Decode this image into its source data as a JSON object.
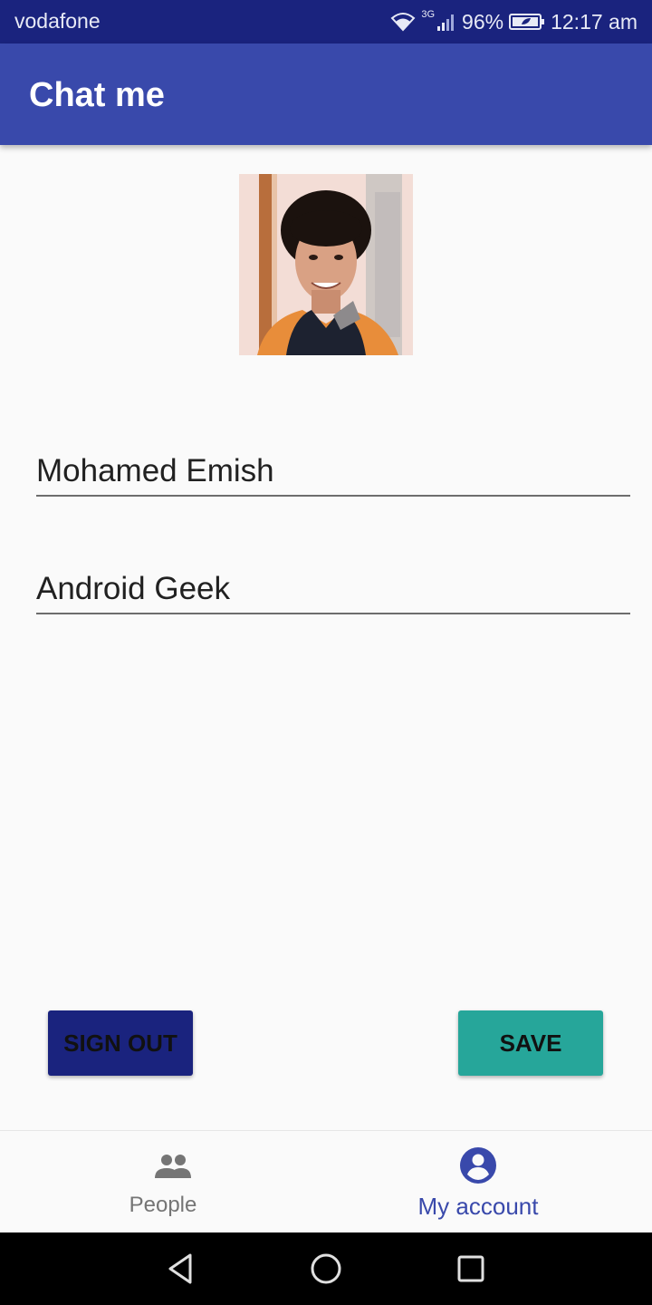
{
  "status_bar": {
    "carrier": "vodafone",
    "network_type": "3G",
    "battery": "96%",
    "time": "12:17 am"
  },
  "app_bar": {
    "title": "Chat me"
  },
  "profile": {
    "avatar_icon": "profile-photo",
    "name_value": "Mohamed Emish",
    "bio_value": "Android Geek"
  },
  "actions": {
    "sign_out_label": "SIGN OUT",
    "save_label": "SAVE"
  },
  "bottom_nav": {
    "items": [
      {
        "label": "People",
        "icon": "people-icon",
        "selected": false
      },
      {
        "label": "My account",
        "icon": "account-circle-icon",
        "selected": true
      }
    ]
  },
  "system_nav": {
    "icons": [
      "back-icon",
      "home-icon",
      "recents-icon"
    ]
  },
  "colors": {
    "status_bar": "#1a237e",
    "app_bar": "#3949ab",
    "sign_out_button": "#1a237e",
    "save_button": "#26a69a",
    "nav_selected": "#3949ab",
    "nav_unselected": "#757575"
  }
}
